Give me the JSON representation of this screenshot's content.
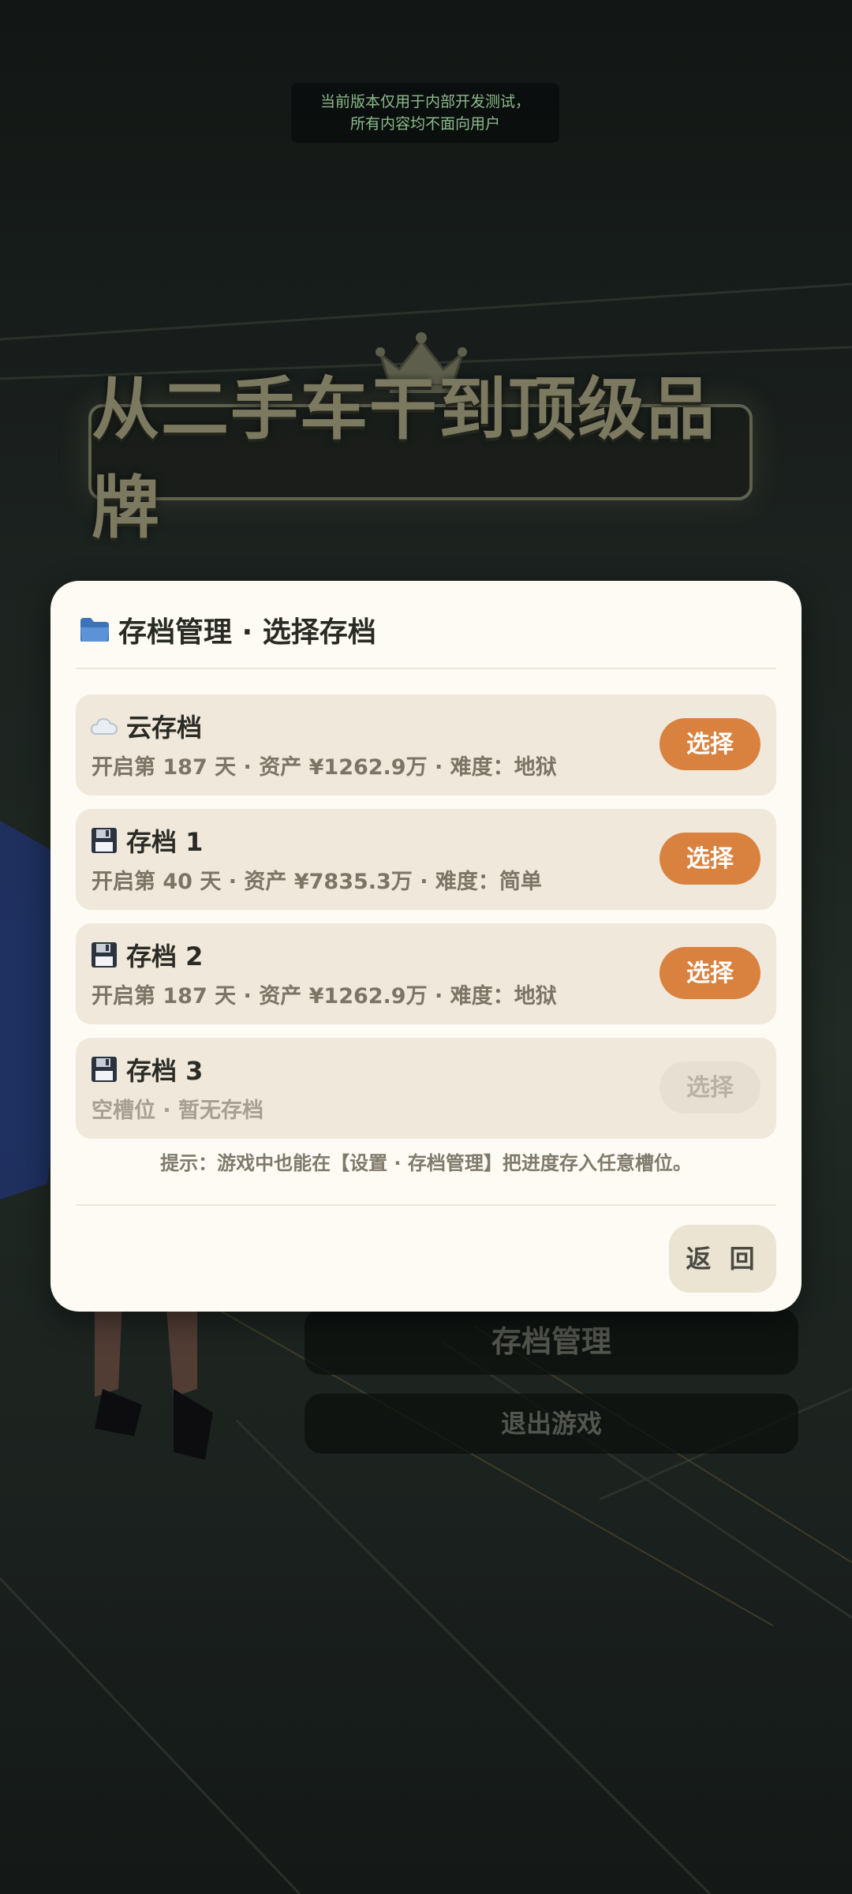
{
  "notice": {
    "line1": "当前版本仅用于内部开发测试，",
    "line2": "所有内容均不面向用户"
  },
  "game_title": "从二手车干到顶级品牌",
  "background_menu": {
    "save_manage_label": "存档管理",
    "exit_label": "退出游戏"
  },
  "modal": {
    "title": "存档管理 · 选择存档",
    "slots": [
      {
        "icon": "cloud-icon",
        "name": "云存档",
        "info": "开启第 187 天 · 资产 ¥1262.9万 · 难度：地狱",
        "button": "选择",
        "enabled": true
      },
      {
        "icon": "floppy-disk-icon",
        "name": "存档 1",
        "info": "开启第 40 天 · 资产 ¥7835.3万 · 难度：简单",
        "button": "选择",
        "enabled": true
      },
      {
        "icon": "floppy-disk-icon",
        "name": "存档 2",
        "info": "开启第 187 天 · 资产 ¥1262.9万 · 难度：地狱",
        "button": "选择",
        "enabled": true
      },
      {
        "icon": "floppy-disk-icon",
        "name": "存档 3",
        "info": "空槽位 · 暂无存档",
        "button": "选择",
        "enabled": false
      }
    ],
    "hint": "提示：游戏中也能在【设置 · 存档管理】把进度存入任意槽位。",
    "back_label": "返 回"
  },
  "colors": {
    "accent": "#d9823f",
    "modal_bg": "#fdfbf4",
    "slot_bg": "#efe8db",
    "notice_text": "#9fd39f"
  }
}
